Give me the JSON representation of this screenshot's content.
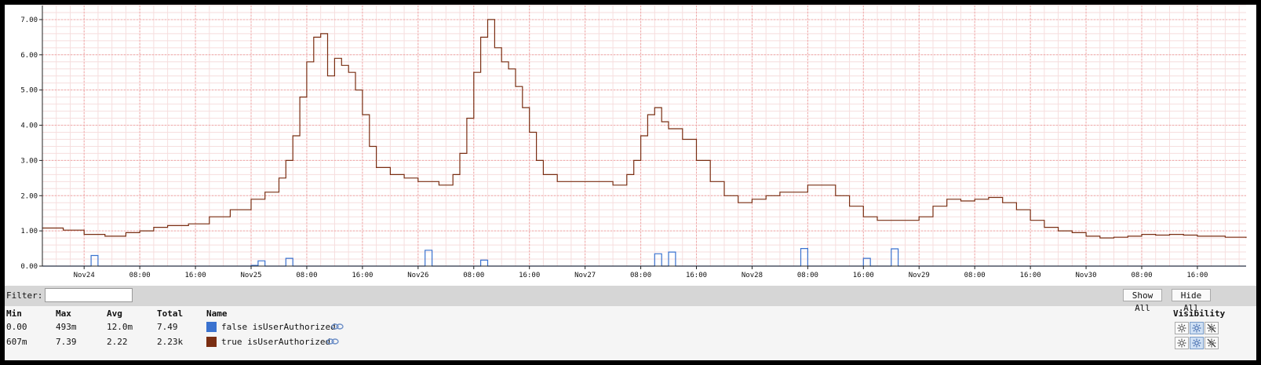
{
  "chart_data": {
    "type": "line",
    "x_type": "date",
    "xlim": [
      "2023-11-23T18:00",
      "2023-11-30T23:00"
    ],
    "ylim": [
      0,
      7.4
    ],
    "ytick_values": [
      0,
      1,
      2,
      3,
      4,
      5,
      6,
      7
    ],
    "ytick_labels": [
      "0.00",
      "1.00",
      "2.00",
      "3.00",
      "4.00",
      "5.00",
      "6.00",
      "7.00"
    ],
    "xtick_values": [
      "2023-11-24T00:00",
      "2023-11-24T08:00",
      "2023-11-24T16:00",
      "2023-11-25T00:00",
      "2023-11-25T08:00",
      "2023-11-25T16:00",
      "2023-11-26T00:00",
      "2023-11-26T08:00",
      "2023-11-26T16:00",
      "2023-11-27T00:00",
      "2023-11-27T08:00",
      "2023-11-27T16:00",
      "2023-11-28T00:00",
      "2023-11-28T08:00",
      "2023-11-28T16:00",
      "2023-11-29T00:00",
      "2023-11-29T08:00",
      "2023-11-29T16:00",
      "2023-11-30T00:00",
      "2023-11-30T08:00",
      "2023-11-30T16:00"
    ],
    "xtick_labels": [
      "Nov24",
      "08:00",
      "16:00",
      "Nov25",
      "08:00",
      "16:00",
      "Nov26",
      "08:00",
      "16:00",
      "Nov27",
      "08:00",
      "16:00",
      "Nov28",
      "08:00",
      "16:00",
      "Nov29",
      "08:00",
      "16:00",
      "Nov30",
      "08:00",
      "16:00"
    ],
    "grid": true,
    "series": [
      {
        "name": "true isUserAuthorized",
        "color": "#7a2e12",
        "points": [
          [
            "2023-11-23T18:00",
            1.08
          ],
          [
            "2023-11-23T21:00",
            1.02
          ],
          [
            "2023-11-24T00:00",
            0.9
          ],
          [
            "2023-11-24T03:00",
            0.85
          ],
          [
            "2023-11-24T06:00",
            0.95
          ],
          [
            "2023-11-24T08:00",
            1.0
          ],
          [
            "2023-11-24T10:00",
            1.1
          ],
          [
            "2023-11-24T12:00",
            1.15
          ],
          [
            "2023-11-24T15:00",
            1.2
          ],
          [
            "2023-11-24T18:00",
            1.4
          ],
          [
            "2023-11-24T21:00",
            1.6
          ],
          [
            "2023-11-25T00:00",
            1.9
          ],
          [
            "2023-11-25T02:00",
            2.1
          ],
          [
            "2023-11-25T04:00",
            2.5
          ],
          [
            "2023-11-25T05:00",
            3.0
          ],
          [
            "2023-11-25T06:00",
            3.7
          ],
          [
            "2023-11-25T07:00",
            4.8
          ],
          [
            "2023-11-25T08:00",
            5.8
          ],
          [
            "2023-11-25T09:00",
            6.5
          ],
          [
            "2023-11-25T10:00",
            6.6
          ],
          [
            "2023-11-25T11:00",
            5.4
          ],
          [
            "2023-11-25T12:00",
            5.9
          ],
          [
            "2023-11-25T13:00",
            5.7
          ],
          [
            "2023-11-25T14:00",
            5.5
          ],
          [
            "2023-11-25T15:00",
            5.0
          ],
          [
            "2023-11-25T16:00",
            4.3
          ],
          [
            "2023-11-25T17:00",
            3.4
          ],
          [
            "2023-11-25T18:00",
            2.8
          ],
          [
            "2023-11-25T20:00",
            2.6
          ],
          [
            "2023-11-25T22:00",
            2.5
          ],
          [
            "2023-11-26T00:00",
            2.4
          ],
          [
            "2023-11-26T02:00",
            2.4
          ],
          [
            "2023-11-26T03:00",
            2.3
          ],
          [
            "2023-11-26T04:00",
            2.3
          ],
          [
            "2023-11-26T05:00",
            2.6
          ],
          [
            "2023-11-26T06:00",
            3.2
          ],
          [
            "2023-11-26T07:00",
            4.2
          ],
          [
            "2023-11-26T08:00",
            5.5
          ],
          [
            "2023-11-26T09:00",
            6.5
          ],
          [
            "2023-11-26T10:00",
            7.0
          ],
          [
            "2023-11-26T11:00",
            6.2
          ],
          [
            "2023-11-26T12:00",
            5.8
          ],
          [
            "2023-11-26T13:00",
            5.6
          ],
          [
            "2023-11-26T14:00",
            5.1
          ],
          [
            "2023-11-26T15:00",
            4.5
          ],
          [
            "2023-11-26T16:00",
            3.8
          ],
          [
            "2023-11-26T17:00",
            3.0
          ],
          [
            "2023-11-26T18:00",
            2.6
          ],
          [
            "2023-11-26T20:00",
            2.4
          ],
          [
            "2023-11-26T22:00",
            2.4
          ],
          [
            "2023-11-27T00:00",
            2.4
          ],
          [
            "2023-11-27T02:00",
            2.4
          ],
          [
            "2023-11-27T04:00",
            2.3
          ],
          [
            "2023-11-27T06:00",
            2.6
          ],
          [
            "2023-11-27T07:00",
            3.0
          ],
          [
            "2023-11-27T08:00",
            3.7
          ],
          [
            "2023-11-27T09:00",
            4.3
          ],
          [
            "2023-11-27T10:00",
            4.5
          ],
          [
            "2023-11-27T11:00",
            4.1
          ],
          [
            "2023-11-27T12:00",
            3.9
          ],
          [
            "2023-11-27T14:00",
            3.6
          ],
          [
            "2023-11-27T16:00",
            3.0
          ],
          [
            "2023-11-27T18:00",
            2.4
          ],
          [
            "2023-11-27T20:00",
            2.0
          ],
          [
            "2023-11-27T22:00",
            1.8
          ],
          [
            "2023-11-28T00:00",
            1.9
          ],
          [
            "2023-11-28T02:00",
            2.0
          ],
          [
            "2023-11-28T04:00",
            2.1
          ],
          [
            "2023-11-28T06:00",
            2.1
          ],
          [
            "2023-11-28T08:00",
            2.3
          ],
          [
            "2023-11-28T10:00",
            2.3
          ],
          [
            "2023-11-28T12:00",
            2.0
          ],
          [
            "2023-11-28T14:00",
            1.7
          ],
          [
            "2023-11-28T16:00",
            1.4
          ],
          [
            "2023-11-28T18:00",
            1.3
          ],
          [
            "2023-11-28T20:00",
            1.3
          ],
          [
            "2023-11-28T22:00",
            1.3
          ],
          [
            "2023-11-29T00:00",
            1.4
          ],
          [
            "2023-11-29T02:00",
            1.7
          ],
          [
            "2023-11-29T04:00",
            1.9
          ],
          [
            "2023-11-29T06:00",
            1.85
          ],
          [
            "2023-11-29T08:00",
            1.9
          ],
          [
            "2023-11-29T10:00",
            1.95
          ],
          [
            "2023-11-29T12:00",
            1.8
          ],
          [
            "2023-11-29T14:00",
            1.6
          ],
          [
            "2023-11-29T16:00",
            1.3
          ],
          [
            "2023-11-29T18:00",
            1.1
          ],
          [
            "2023-11-29T20:00",
            1.0
          ],
          [
            "2023-11-29T22:00",
            0.95
          ],
          [
            "2023-11-30T00:00",
            0.85
          ],
          [
            "2023-11-30T02:00",
            0.8
          ],
          [
            "2023-11-30T04:00",
            0.82
          ],
          [
            "2023-11-30T06:00",
            0.85
          ],
          [
            "2023-11-30T08:00",
            0.9
          ],
          [
            "2023-11-30T10:00",
            0.88
          ],
          [
            "2023-11-30T12:00",
            0.9
          ],
          [
            "2023-11-30T14:00",
            0.88
          ],
          [
            "2023-11-30T16:00",
            0.85
          ],
          [
            "2023-11-30T18:00",
            0.85
          ],
          [
            "2023-11-30T20:00",
            0.82
          ],
          [
            "2023-11-30T23:00",
            0.8
          ]
        ]
      },
      {
        "name": "false isUserAuthorized",
        "color": "#3a72cf",
        "points": [
          [
            "2023-11-23T18:00",
            0.0
          ],
          [
            "2023-11-24T00:00",
            0.0
          ],
          [
            "2023-11-24T01:00",
            0.3
          ],
          [
            "2023-11-24T02:00",
            0.0
          ],
          [
            "2023-11-25T00:00",
            0.02
          ],
          [
            "2023-11-25T01:00",
            0.15
          ],
          [
            "2023-11-25T02:00",
            0.0
          ],
          [
            "2023-11-25T04:00",
            0.0
          ],
          [
            "2023-11-25T05:00",
            0.22
          ],
          [
            "2023-11-25T06:00",
            0.0
          ],
          [
            "2023-11-26T00:00",
            0.0
          ],
          [
            "2023-11-26T01:00",
            0.45
          ],
          [
            "2023-11-26T02:00",
            0.0
          ],
          [
            "2023-11-26T08:00",
            0.0
          ],
          [
            "2023-11-26T09:00",
            0.17
          ],
          [
            "2023-11-26T10:00",
            0.0
          ],
          [
            "2023-11-27T09:00",
            0.0
          ],
          [
            "2023-11-27T10:00",
            0.35
          ],
          [
            "2023-11-27T11:00",
            0.0
          ],
          [
            "2023-11-27T12:00",
            0.4
          ],
          [
            "2023-11-27T13:00",
            0.0
          ],
          [
            "2023-11-28T06:00",
            0.0
          ],
          [
            "2023-11-28T07:00",
            0.5
          ],
          [
            "2023-11-28T08:00",
            0.0
          ],
          [
            "2023-11-28T15:00",
            0.0
          ],
          [
            "2023-11-28T16:00",
            0.22
          ],
          [
            "2023-11-28T17:00",
            0.0
          ],
          [
            "2023-11-28T19:00",
            0.0
          ],
          [
            "2023-11-28T20:00",
            0.49
          ],
          [
            "2023-11-28T21:00",
            0.0
          ],
          [
            "2023-11-30T23:00",
            0.0
          ]
        ]
      }
    ]
  },
  "filter": {
    "label": "Filter:",
    "value": "",
    "placeholder": ""
  },
  "toolbar": {
    "show_all_label": "Show All",
    "hide_all_label": "Hide All"
  },
  "legend": {
    "headers": {
      "min": "Min",
      "max": "Max",
      "avg": "Avg",
      "total": "Total",
      "name": "Name",
      "visibility": "Visibility"
    },
    "rows": [
      {
        "min": "0.00",
        "max": "493m",
        "avg": "12.0m",
        "total": "7.49",
        "name": "false isUserAuthorized",
        "color": "#3a72cf"
      },
      {
        "min": "607m",
        "max": "7.39",
        "avg": "2.22",
        "total": "2.23k",
        "name": "true isUserAuthorized",
        "color": "#7a2e12"
      }
    ]
  }
}
